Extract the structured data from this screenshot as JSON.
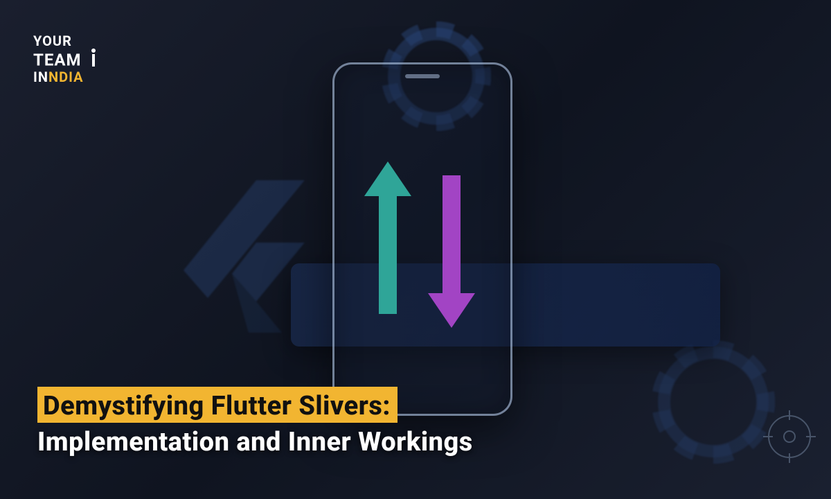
{
  "logo": {
    "line1": "YOUR",
    "line2": "TEAM",
    "line3_part1": "IN",
    "line3_part2": "NDIA"
  },
  "title": {
    "line1": "Demystifying Flutter Slivers:",
    "line2": "Implementation and Inner Workings"
  },
  "colors": {
    "highlight": "#f2b531",
    "arrow_up": "#2fa598",
    "arrow_down": "#a244c4"
  }
}
